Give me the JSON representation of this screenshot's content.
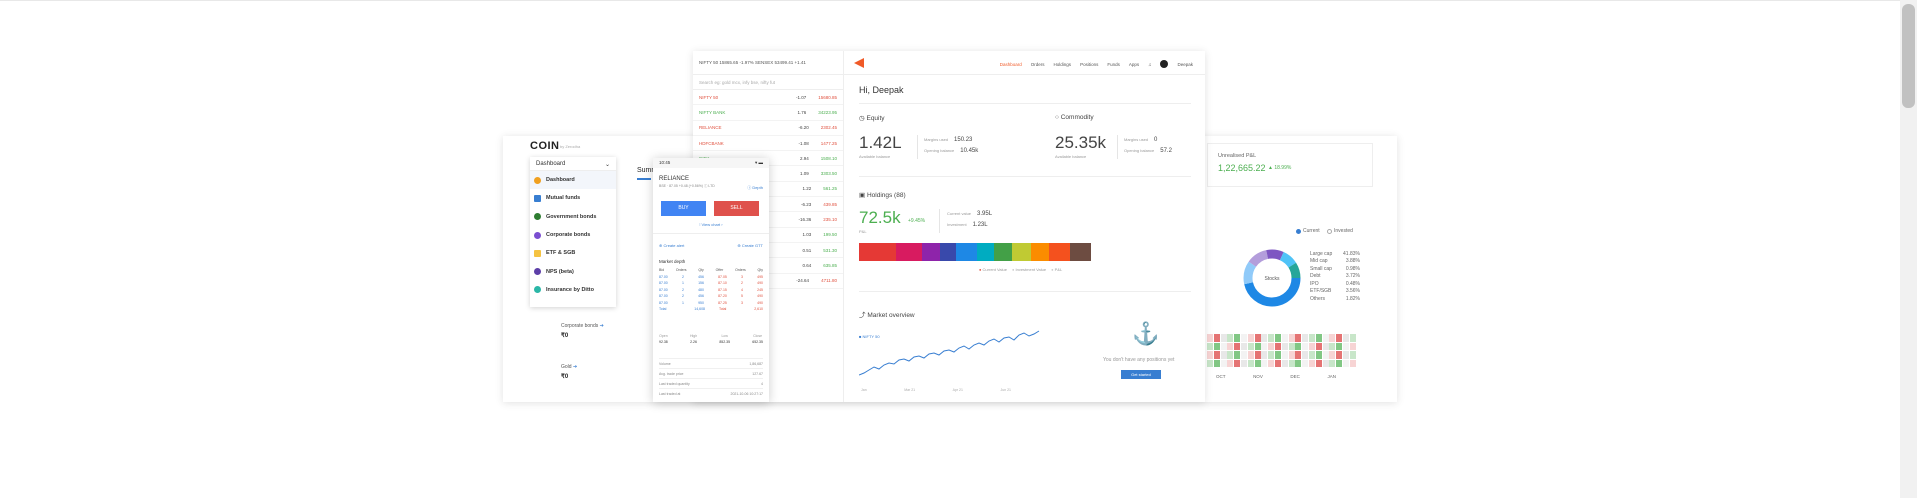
{
  "coin": {
    "logo": "COIN",
    "logo_sub": "by Zerodha",
    "dropdown_label": "Dashboard",
    "menu": [
      {
        "label": "Dashboard",
        "icon": "dashboard-icon",
        "color": "#f0a020"
      },
      {
        "label": "Mutual funds",
        "icon": "bank-icon",
        "color": "#387ed1"
      },
      {
        "label": "Government bonds",
        "icon": "shield-icon",
        "color": "#2e7d32"
      },
      {
        "label": "Corporate bonds",
        "icon": "badge-icon",
        "color": "#7b4fd1"
      },
      {
        "label": "ETF & SGB",
        "icon": "gold-icon",
        "color": "#f5c342"
      },
      {
        "label": "NPS (beta)",
        "icon": "umbrella-icon",
        "color": "#5d3fa8"
      },
      {
        "label": "Insurance by Ditto",
        "icon": "ditto-icon",
        "color": "#2bb7a7"
      }
    ],
    "tab": "Summ",
    "corporate_bonds": {
      "label": "Corporate bonds",
      "value": "₹0"
    },
    "gold": {
      "label": "Gold",
      "value": "₹0"
    },
    "unrealised_label": "Unrealised P&L",
    "unrealised_value": "1,22,665.22",
    "unrealised_pct": "▲ 18.99%",
    "legend_current": "Current",
    "legend_invested": "Invested",
    "donut_center": "Stocks",
    "donut_legend": [
      "Large cap",
      "Mid cap",
      "Small cap",
      "Debt",
      "IPO",
      "ETF/SGB",
      "Others"
    ],
    "donut_pct": [
      "41.83%",
      "3.88%",
      "0.98%",
      "3.72%",
      "0.48%",
      "3.56%",
      "1.82%"
    ],
    "heat_months": [
      "OCT",
      "NOV",
      "DEC",
      "JAN"
    ]
  },
  "kite": {
    "indices": "NIFTY 50  15865.65  -1.97%     SENSEX  53499.41  +1.41",
    "search_placeholder": "Search eg: gold mcx, infy bse, nifty fut",
    "watchlist": [
      {
        "sym": "NIFTY 50",
        "chg": "-1.07",
        "ltp": "15680.85",
        "up": false
      },
      {
        "sym": "NIFTY BANK",
        "chg": "1.76",
        "ltp": "34223.95",
        "up": true
      },
      {
        "sym": "RELIANCE",
        "chg": "-6.20",
        "ltp": "2302.45",
        "up": false
      },
      {
        "sym": "HDFCBANK",
        "chg": "-1.08",
        "ltp": "1477.25",
        "up": false
      },
      {
        "sym": "INFY",
        "chg": "2.94",
        "ltp": "1508.10",
        "up": true
      },
      {
        "sym": "TCS",
        "chg": "1.09",
        "ltp": "3303.50",
        "up": true
      },
      {
        "sym": "ICICIBANK",
        "chg": "1.22",
        "ltp": "561.25",
        "up": true
      },
      {
        "sym": "SBIN",
        "chg": "-6.23",
        "ltp": "439.85",
        "up": false
      },
      {
        "sym": "TATAMOTORS",
        "chg": "-16.36",
        "ltp": "235.10",
        "up": false
      },
      {
        "sym": "ITC",
        "chg": "1.03",
        "ltp": "199.50",
        "up": true
      },
      {
        "sym": "WIPRO",
        "chg": "0.51",
        "ltp": "531.30",
        "up": true
      },
      {
        "sym": "AXISBANK",
        "chg": "0.64",
        "ltp": "635.85",
        "up": true
      },
      {
        "sym": "GOLD",
        "chg": "-24.64",
        "ltp": "4711.80",
        "up": false
      }
    ],
    "nav": [
      "Dashboard",
      "Orders",
      "Holdings",
      "Positions",
      "Funds",
      "Apps"
    ],
    "user": "Deepak",
    "greeting": "Hi, Deepak",
    "equity": {
      "title": "Equity",
      "value": "1.42L",
      "sub": "Available balance",
      "margins_label": "Margins used",
      "margins": "150.23",
      "opening_label": "Opening balance",
      "opening": "10.45k"
    },
    "commodity": {
      "title": "Commodity",
      "value": "25.35k",
      "sub": "Available balance",
      "margins_label": "Margins used",
      "margins": "0",
      "opening_label": "Opening balance",
      "opening": "57.2"
    },
    "holdings": {
      "title": "Holdings (88)",
      "value": "72.5k",
      "pct": "+9.45%",
      "sub": "P&L",
      "current_label": "Current value",
      "current": "3.95L",
      "invest_label": "Investment",
      "invest": "1.23L",
      "legend": [
        "Current Value",
        "Investment Value",
        "P&L"
      ],
      "bar_colors": [
        "#e53935",
        "#d81b60",
        "#8e24aa",
        "#3949ab",
        "#1e88e5",
        "#00acc1",
        "#43a047",
        "#c0ca33",
        "#fb8c00",
        "#f4511e",
        "#6d4c41"
      ]
    },
    "market": {
      "title": "Market overview",
      "series": "NIFTY 50",
      "x_ticks": [
        "Jan",
        "Mar 21",
        "Apr 21",
        "Jun 21"
      ]
    },
    "positions": {
      "empty": "You don't have any positions yet",
      "button": "Get started"
    }
  },
  "phone": {
    "time": "10:45",
    "title": "RELIANCE",
    "sub": "BSE  · 87.05 +0.48 (+0.56%)  ⓘ  LTD",
    "depth_link": "Depth",
    "buy": "BUY",
    "sell": "SELL",
    "view_chart": "View chart",
    "create_alert": "Create alert",
    "create_gtt": "Create GTT",
    "depth_title": "Market depth",
    "depth_head": [
      "Bid",
      "Orders",
      "Qty",
      "Offer",
      "Orders",
      "Qty"
    ],
    "depth_rows": [
      [
        "87.00",
        "2",
        "456",
        "87.05",
        "3",
        "495"
      ],
      [
        "87.00",
        "1",
        "156",
        "87.10",
        "2",
        "490"
      ],
      [
        "87.00",
        "2",
        "480",
        "87.15",
        "4",
        "245"
      ],
      [
        "87.00",
        "2",
        "456",
        "87.20",
        "5",
        "490"
      ],
      [
        "87.00",
        "1",
        "950",
        "87.25",
        "3",
        "490"
      ]
    ],
    "depth_total": [
      "Total",
      "",
      "14,608",
      "Total",
      "",
      "2,610"
    ],
    "stats": [
      {
        "label": "Open",
        "value": "92.38"
      },
      {
        "label": "High",
        "value": "2.26"
      },
      {
        "label": "Low",
        "value": "852.35"
      },
      {
        "label": "Close",
        "value": "652.35"
      }
    ],
    "kv": [
      {
        "k": "Volume",
        "v": "1,86,687"
      },
      {
        "k": "Avg. trade price",
        "v": "127.67"
      },
      {
        "k": "Last traded quantity",
        "v": "4"
      },
      {
        "k": "Last traded at",
        "v": "2021-10-06 10:27:17"
      }
    ]
  }
}
